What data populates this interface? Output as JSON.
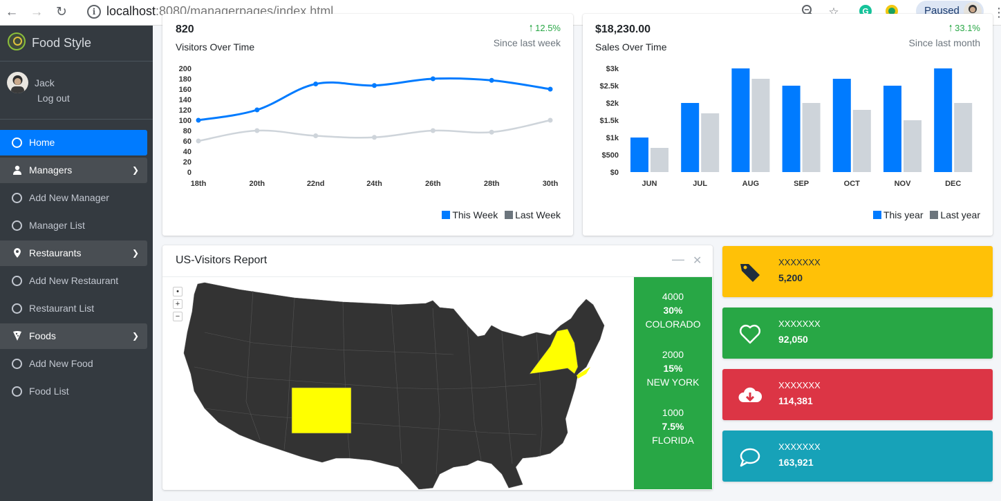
{
  "browser": {
    "url_host": "localhost",
    "url_rest": ":8080/managerpages/index.html",
    "profile_status": "Paused"
  },
  "sidebar": {
    "brand": "Food Style",
    "user": {
      "name": "Jack",
      "logout": "Log out"
    },
    "items": [
      {
        "label": "Home"
      },
      {
        "label": "Managers"
      },
      {
        "label": "Add New Manager"
      },
      {
        "label": "Manager List"
      },
      {
        "label": "Restaurants"
      },
      {
        "label": "Add New Restaurant"
      },
      {
        "label": "Restaurant List"
      },
      {
        "label": "Foods"
      },
      {
        "label": "Add New Food"
      },
      {
        "label": "Food List"
      }
    ]
  },
  "visitors": {
    "value": "820",
    "subtitle": "Visitors Over Time",
    "pct": "12.5%",
    "since": "Since last week",
    "legend": [
      "This Week",
      "Last Week"
    ]
  },
  "sales": {
    "value": "$18,230.00",
    "subtitle": "Sales Over Time",
    "pct": "33.1%",
    "since": "Since last month",
    "legend": [
      "This year",
      "Last year"
    ]
  },
  "chart_data": [
    {
      "type": "line",
      "title": "Visitors Over Time",
      "x": [
        "18th",
        "20th",
        "22nd",
        "24th",
        "26th",
        "28th",
        "30th"
      ],
      "y_ticks": [
        "0",
        "20",
        "40",
        "60",
        "80",
        "100",
        "120",
        "140",
        "160",
        "180",
        "200"
      ],
      "ylim": [
        0,
        200
      ],
      "series": [
        {
          "name": "This Week",
          "color": "#007bff",
          "values": [
            100,
            120,
            170,
            167,
            180,
            177,
            160
          ]
        },
        {
          "name": "Last Week",
          "color": "#ced4da",
          "values": [
            60,
            80,
            70,
            67,
            80,
            77,
            100
          ]
        }
      ],
      "legend": "bottom-right",
      "grid": false
    },
    {
      "type": "bar",
      "title": "Sales Over Time",
      "categories": [
        "JUN",
        "JUL",
        "AUG",
        "SEP",
        "OCT",
        "NOV",
        "DEC"
      ],
      "y_ticks": [
        "$0",
        "$500",
        "$1k",
        "$1.5k",
        "$2k",
        "$2.5k",
        "$3k"
      ],
      "ylim": [
        0,
        3000
      ],
      "series": [
        {
          "name": "This year",
          "color": "#007bff",
          "values": [
            1000,
            2000,
            3000,
            2500,
            2700,
            2500,
            3000
          ]
        },
        {
          "name": "Last year",
          "color": "#ced4da",
          "values": [
            700,
            1700,
            2700,
            2000,
            1800,
            1500,
            2000
          ]
        }
      ],
      "legend": "bottom-right",
      "grid": false
    }
  ],
  "map": {
    "title": "US-Visitors Report",
    "highlight_color": "#ffff00",
    "stats": [
      {
        "count": "4000",
        "pct": "30%",
        "state": "COLORADO"
      },
      {
        "count": "2000",
        "pct": "15%",
        "state": "NEW YORK"
      },
      {
        "count": "1000",
        "pct": "7.5%",
        "state": "FLORIDA"
      }
    ]
  },
  "info_boxes": [
    {
      "label": "XXXXXXX",
      "value": "5,200",
      "icon": "tag-icon",
      "color": "#ffc107"
    },
    {
      "label": "XXXXXXX",
      "value": "92,050",
      "icon": "heart-icon",
      "color": "#28a745"
    },
    {
      "label": "XXXXXXX",
      "value": "114,381",
      "icon": "cloud-download-icon",
      "color": "#dc3545"
    },
    {
      "label": "XXXXXXX",
      "value": "163,921",
      "icon": "comment-icon",
      "color": "#17a2b8"
    }
  ]
}
